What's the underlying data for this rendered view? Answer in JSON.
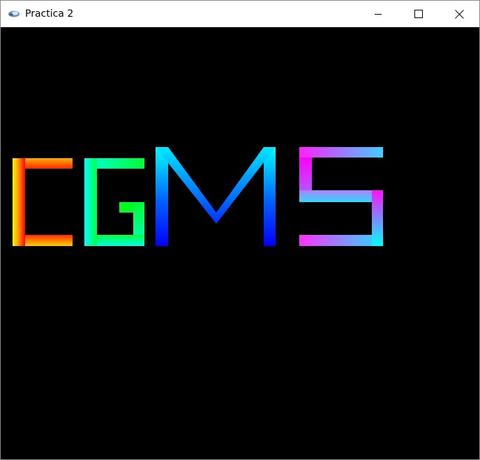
{
  "window": {
    "title": "Practica 2",
    "app_icon": "opengl-app-icon",
    "controls": [
      {
        "name": "minimize-button",
        "icon": "minimize-icon"
      },
      {
        "name": "maximize-button",
        "icon": "maximize-icon"
      },
      {
        "name": "close-button",
        "icon": "close-icon"
      }
    ]
  },
  "canvas": {
    "background": "#000000",
    "rendered_text": "CGMS",
    "letters": [
      {
        "letter": "C",
        "colors": [
          "#ffff00",
          "#ff8000",
          "#ff0000"
        ]
      },
      {
        "letter": "G",
        "colors": [
          "#00ff00",
          "#00ffd0",
          "#00ffff"
        ]
      },
      {
        "letter": "M",
        "colors": [
          "#00ffff",
          "#0080ff",
          "#0000ff"
        ]
      },
      {
        "letter": "S",
        "colors": [
          "#ff00ff",
          "#00ffff"
        ]
      }
    ]
  }
}
